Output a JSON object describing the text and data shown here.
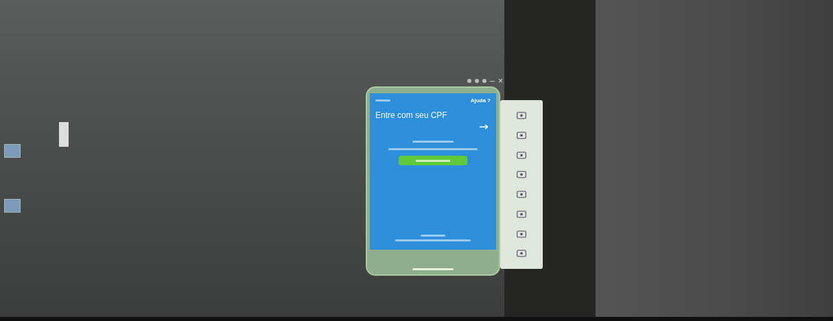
{
  "emulator": {
    "window_controls": [
      "–",
      "×"
    ],
    "screen": {
      "help_link": "Ajuda ?",
      "heading": "Entre com seu CPF"
    }
  }
}
